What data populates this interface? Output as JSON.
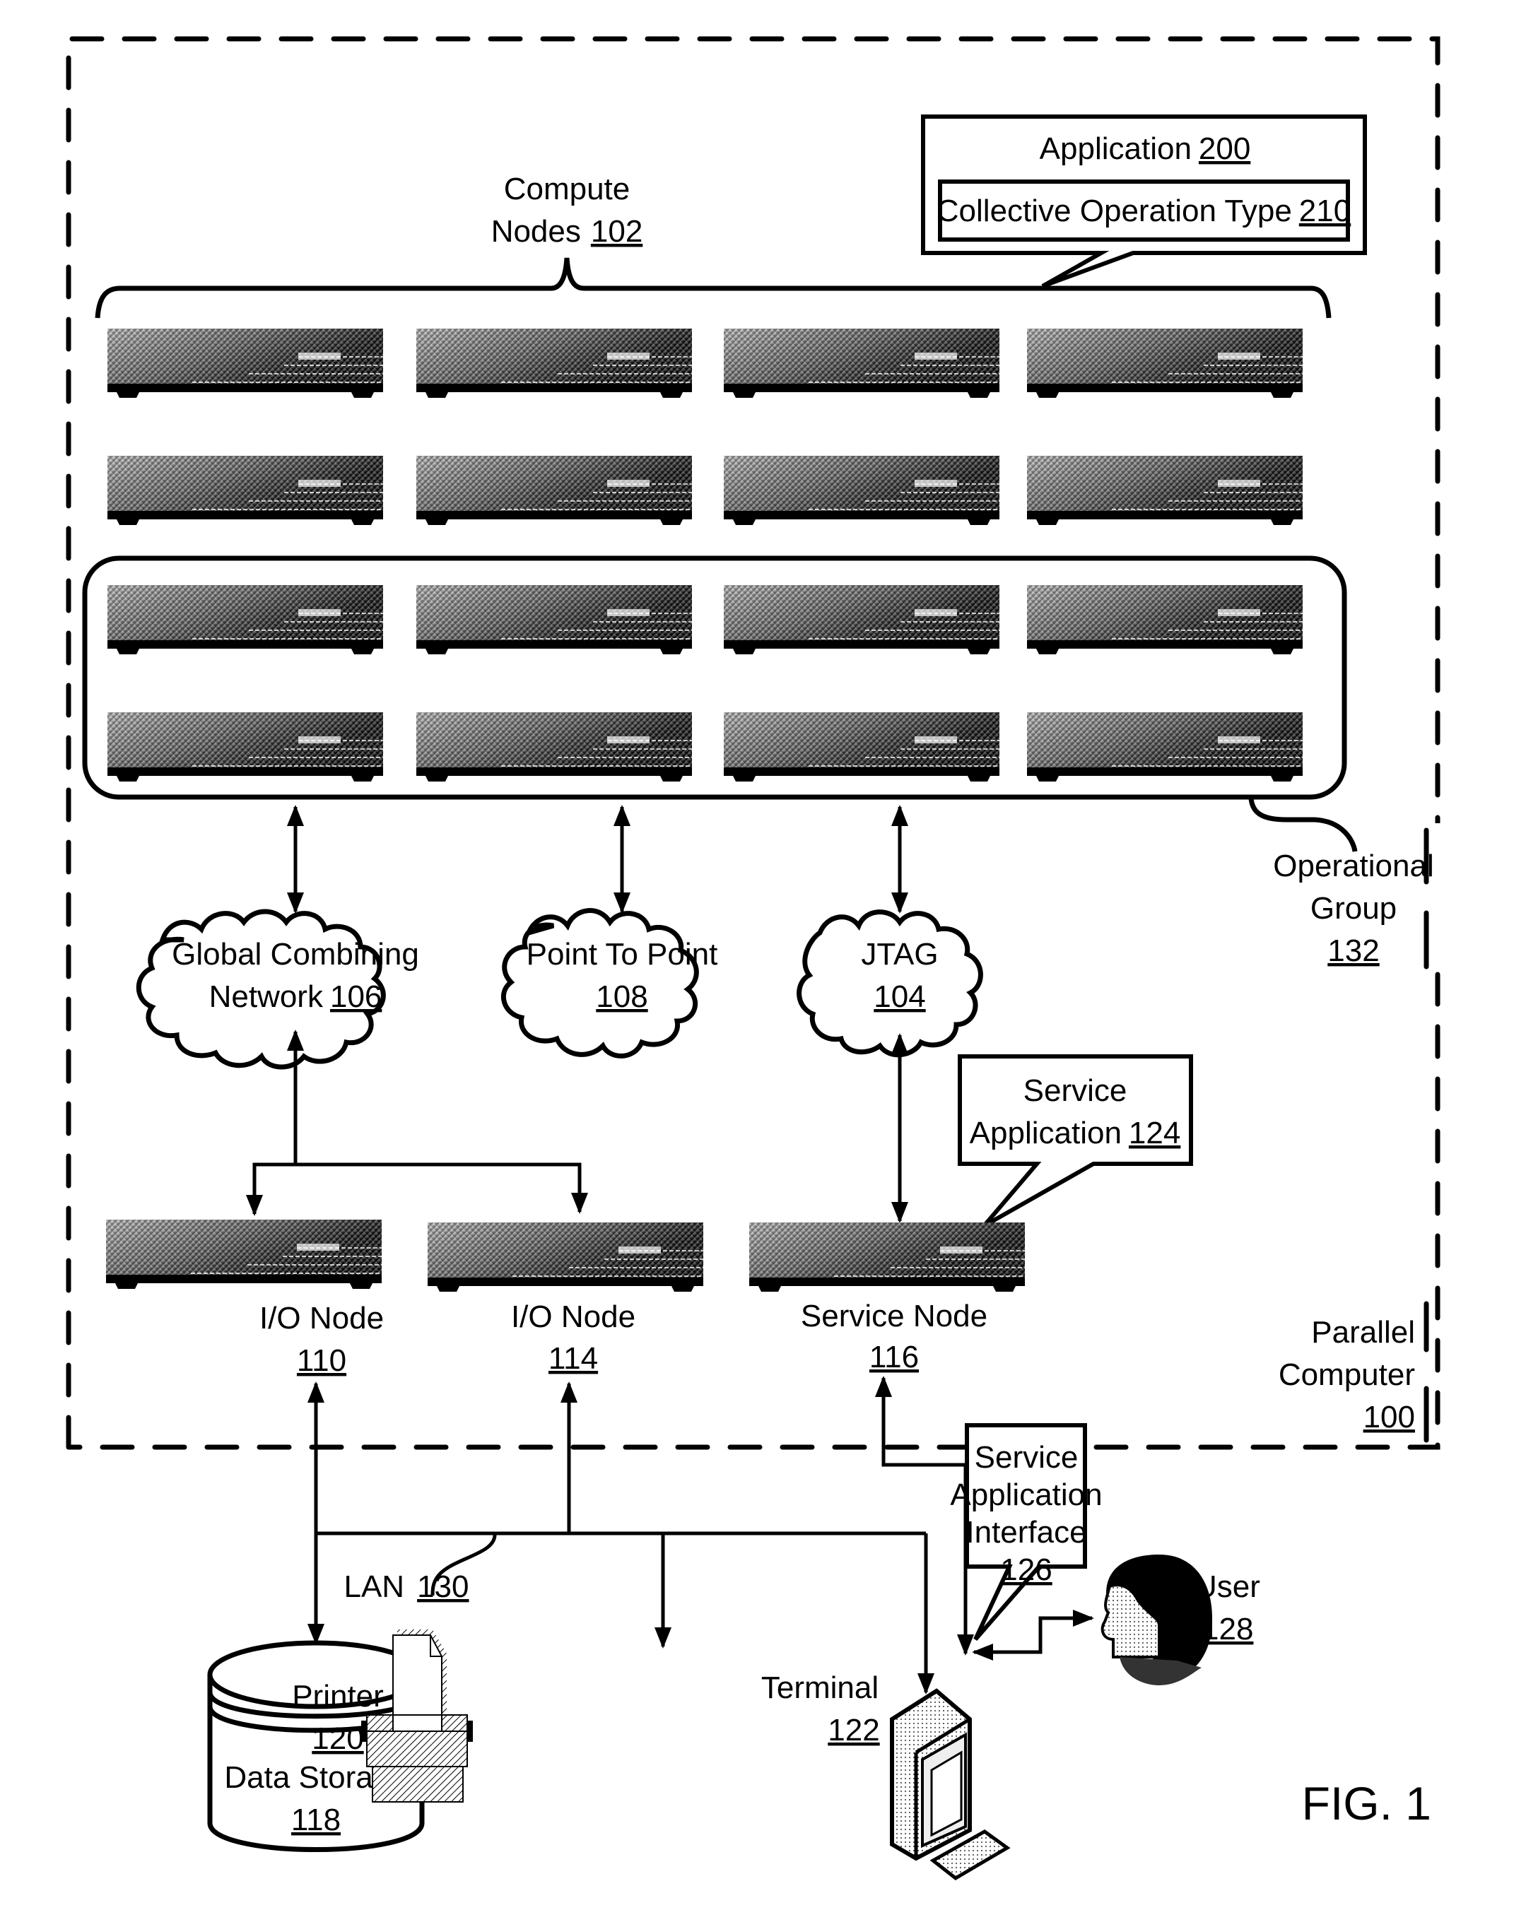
{
  "figure": {
    "label": "FIG. 1"
  },
  "parallel_computer": {
    "name": "Parallel",
    "name2": "Computer",
    "ref": "100"
  },
  "compute_nodes": {
    "line1": "Compute",
    "line2": "Nodes",
    "ref": "102",
    "rows": 4,
    "cols": 4
  },
  "application": {
    "label": "Application",
    "ref": "200",
    "inner_label": "Collective Operation Type",
    "inner_ref": "210"
  },
  "operational_group": {
    "line1": "Operational",
    "line2": "Group",
    "ref": "132"
  },
  "networks": [
    {
      "id": "global-combining",
      "line1": "Global Combining",
      "line2": "Network",
      "ref": "106"
    },
    {
      "id": "point-to-point",
      "line1": "Point To Point",
      "line2": "",
      "ref": "108"
    },
    {
      "id": "jtag",
      "line1": "JTAG",
      "line2": "",
      "ref": "104"
    }
  ],
  "service_application": {
    "line1": "Service",
    "line2": "Application",
    "ref": "124"
  },
  "nodes": [
    {
      "id": "io-node-110",
      "label": "I/O Node",
      "ref": "110"
    },
    {
      "id": "io-node-114",
      "label": "I/O Node",
      "ref": "114"
    },
    {
      "id": "service-node-116",
      "label": "Service Node",
      "ref": "116"
    }
  ],
  "lan": {
    "label": "LAN",
    "ref": "130"
  },
  "data_storage": {
    "label": "Data Storage",
    "ref": "118"
  },
  "printer": {
    "label": "Printer",
    "ref": "120"
  },
  "terminal": {
    "label": "Terminal",
    "ref": "122"
  },
  "service_app_interface": {
    "line1": "Service",
    "line2": "Application",
    "line3": "Interface",
    "ref": "126"
  },
  "user": {
    "label": "User",
    "ref": "128"
  }
}
